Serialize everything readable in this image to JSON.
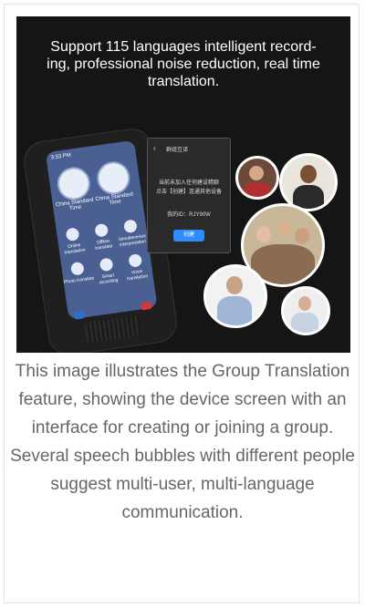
{
  "banner": {
    "headline": "Support 115 languages intelligent record-\ning, professional noise reduction, real time\ntranslation."
  },
  "device": {
    "status_time": "3:33 PM",
    "clocks": [
      {
        "label": "China Standard Time"
      },
      {
        "label": "China Standard Time"
      }
    ],
    "apps": [
      {
        "label": "Online translation"
      },
      {
        "label": "Offline translate"
      },
      {
        "label": "Simultaneous interpretation"
      },
      {
        "label": "Photo translate"
      },
      {
        "label": "Smart recording"
      },
      {
        "label": "Voice translation"
      }
    ]
  },
  "dialog": {
    "title": "群组互译",
    "message": "当前未加入任何建设精聊\n点击【创建】连通其他设备",
    "id_text": "我的ID：RJY90W",
    "create_button": "创建"
  },
  "caption": "This image illustrates the Group Translation feature, showing the device screen with an interface for creating or joining a group. Several speech bubbles with different people suggest multi-user, multi-language communication.",
  "colors": {
    "banner_bg": "#151515",
    "screen_bg": "#4a5f92",
    "accent": "#2d8cff",
    "caption_text": "#666666"
  }
}
